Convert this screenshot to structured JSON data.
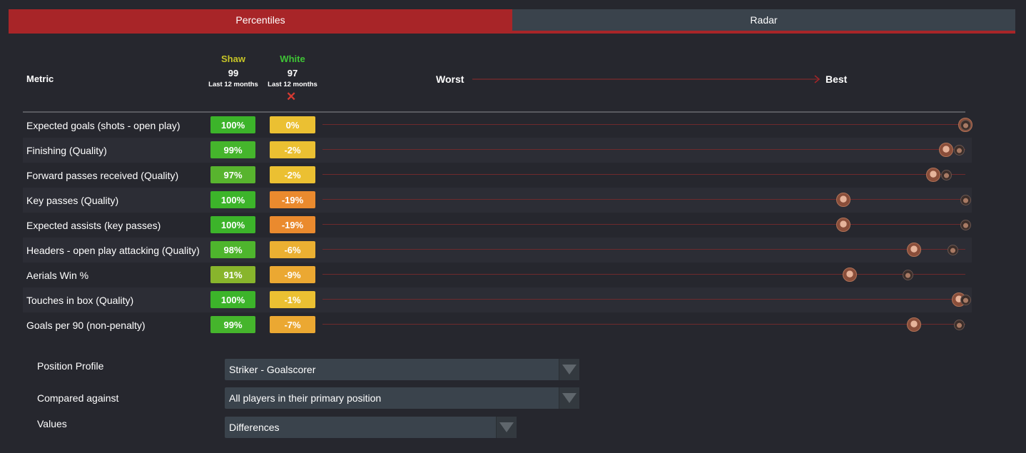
{
  "tabs": [
    {
      "label": "Percentiles",
      "active": true
    },
    {
      "label": "Radar",
      "active": false
    }
  ],
  "header": {
    "metric_label": "Metric",
    "worst_label": "Worst",
    "best_label": "Best",
    "players": [
      {
        "name": "Shaw",
        "name_color": "#c6c427",
        "score": "99",
        "period": "Last 12 months"
      },
      {
        "name": "White",
        "name_color": "#3fc436",
        "score": "97",
        "period": "Last 12 months"
      }
    ]
  },
  "rows": [
    {
      "metric": "Expected goals (shots - open play)",
      "shaw": "100%",
      "shaw_color": "#3cb42a",
      "white": "0%",
      "white_color": "#ebc032",
      "shaw_pct": 100,
      "white_pct": 100
    },
    {
      "metric": "Finishing (Quality)",
      "shaw": "99%",
      "shaw_color": "#45b52c",
      "white": "-2%",
      "white_color": "#ebc032",
      "shaw_pct": 97,
      "white_pct": 99
    },
    {
      "metric": "Forward passes received (Quality)",
      "shaw": "97%",
      "shaw_color": "#58b42e",
      "white": "-2%",
      "white_color": "#ebc032",
      "shaw_pct": 95,
      "white_pct": 97
    },
    {
      "metric": "Key passes (Quality)",
      "shaw": "100%",
      "shaw_color": "#3cb42a",
      "white": "-19%",
      "white_color": "#ea8a2e",
      "shaw_pct": 81,
      "white_pct": 100
    },
    {
      "metric": "Expected assists (key passes)",
      "shaw": "100%",
      "shaw_color": "#3cb42a",
      "white": "-19%",
      "white_color": "#ea8a2e",
      "shaw_pct": 81,
      "white_pct": 100
    },
    {
      "metric": "Headers - open play attacking (Quality)",
      "shaw": "98%",
      "shaw_color": "#4eb52d",
      "white": "-6%",
      "white_color": "#ebb032",
      "shaw_pct": 92,
      "white_pct": 98
    },
    {
      "metric": "Aerials Win %",
      "shaw": "91%",
      "shaw_color": "#88b52c",
      "white": "-9%",
      "white_color": "#eba832",
      "shaw_pct": 82,
      "white_pct": 91
    },
    {
      "metric": "Touches in box (Quality)",
      "shaw": "100%",
      "shaw_color": "#3cb42a",
      "white": "-1%",
      "white_color": "#ebc032",
      "shaw_pct": 99,
      "white_pct": 100
    },
    {
      "metric": "Goals per 90 (non-penalty)",
      "shaw": "99%",
      "shaw_color": "#45b52c",
      "white": "-7%",
      "white_color": "#eba832",
      "shaw_pct": 92,
      "white_pct": 99
    }
  ],
  "controls": {
    "position_profile_label": "Position Profile",
    "position_profile_value": "Striker - Goalscorer",
    "compared_against_label": "Compared against",
    "compared_against_value": "All players in their primary position",
    "values_label": "Values",
    "values_value": "Differences"
  },
  "icons": {
    "remove": "close-icon",
    "dropdown": "chevron-down-icon",
    "scale_arrow": "arrow-right-icon",
    "player_marker": "avatar"
  },
  "colors": {
    "accent": "#a82528",
    "background": "#26272e",
    "tab_inactive": "#3a434c",
    "remove_x": "#d63a32"
  }
}
